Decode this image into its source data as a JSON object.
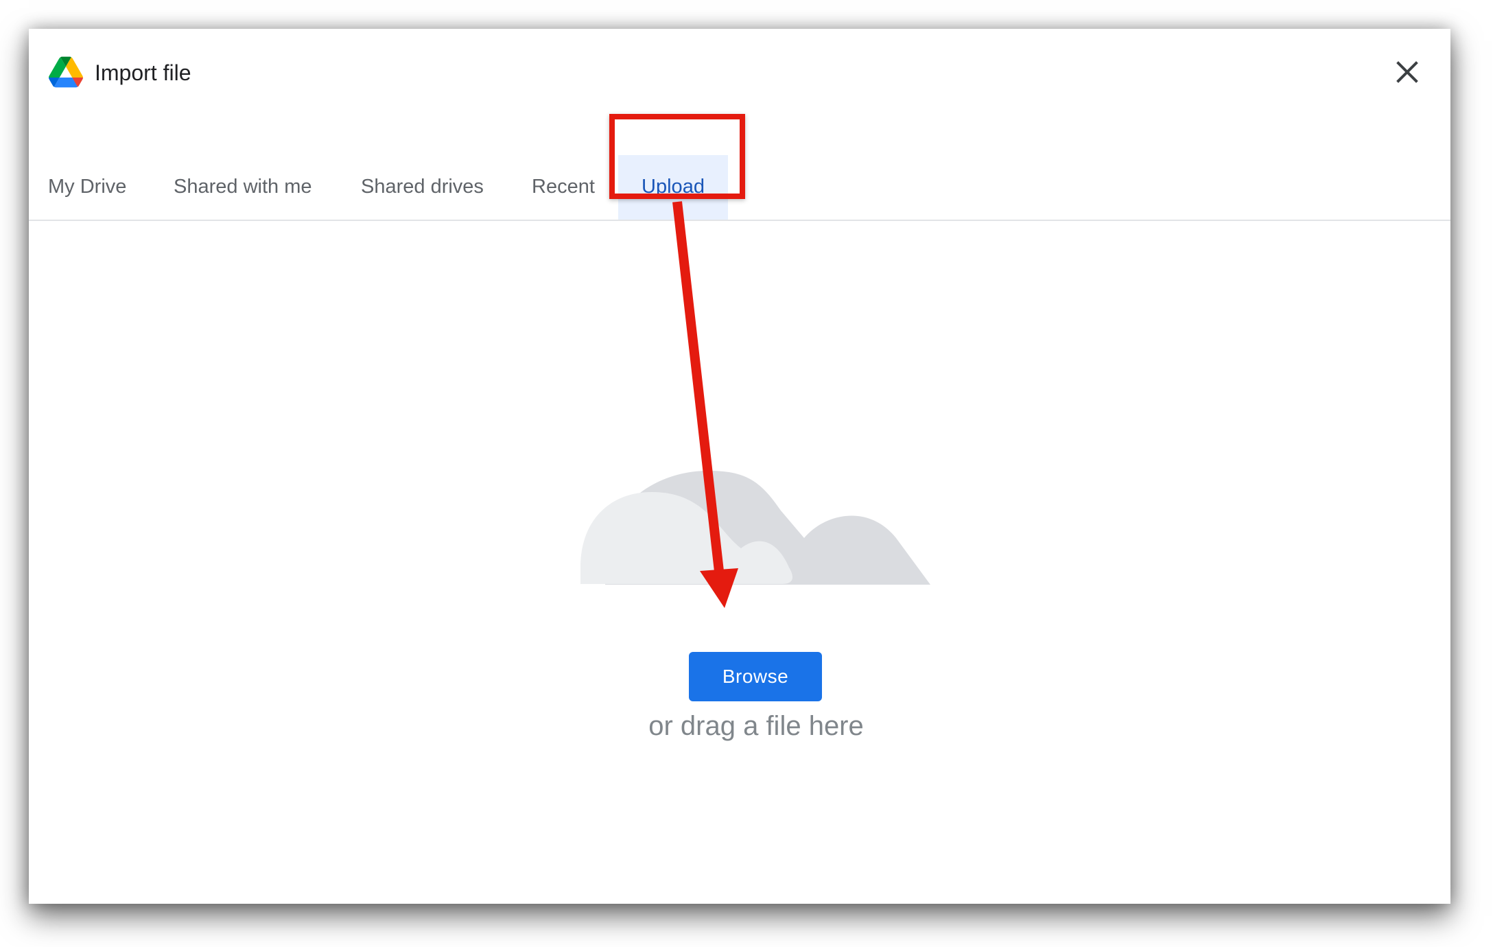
{
  "dialog": {
    "title": "Import file",
    "logo_icon": "google-drive-logo-icon",
    "close_icon": "close-icon"
  },
  "tabs": [
    {
      "label": "My Drive",
      "selected": false
    },
    {
      "label": "Shared with me",
      "selected": false
    },
    {
      "label": "Shared drives",
      "selected": false
    },
    {
      "label": "Recent",
      "selected": false
    },
    {
      "label": "Upload",
      "selected": true
    }
  ],
  "upload": {
    "illustration_icon": "cloud-illustration-icon",
    "browse_label": "Browse",
    "drag_hint": "or drag a file here"
  },
  "annotation": {
    "highlight_color": "#e41b0f",
    "arrow_color": "#e41b0f"
  },
  "colors": {
    "accent": "#1a73e8",
    "active_tab_text": "#1a56b8",
    "active_tab_bg": "#e8f0fe"
  }
}
